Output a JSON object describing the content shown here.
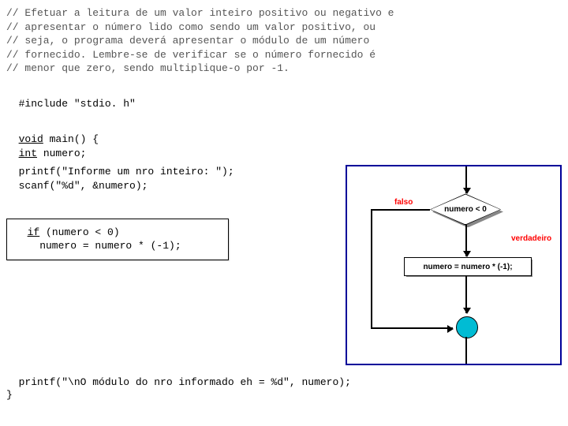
{
  "comments": {
    "l1": "// Efetuar a leitura de um valor inteiro positivo ou negativo e",
    "l2": "// apresentar o número lido como sendo um valor positivo, ou",
    "l3": "// seja, o programa deverá apresentar o módulo de um número",
    "l4": "// fornecido. Lembre-se de verificar se o número fornecido é",
    "l5": "// menor que zero, sendo multiplique-o por -1."
  },
  "code": {
    "include_pre": "#include",
    "include_hdr": " \"stdio. h\"",
    "void": "void",
    "main_sig": " main() {",
    "int": "int",
    "decl": " numero;",
    "printf1": "  printf(\"Informe um nro inteiro: \");",
    "scanf": "  scanf(\"%d\", &numero);",
    "if_kw": "if",
    "if_cond": " (numero < 0)",
    "if_body": "    numero = numero * (-1);",
    "printf2": "  printf(\"\\nO módulo do nro informado eh = %d\", numero);",
    "close": "}"
  },
  "flow": {
    "false_label": "falso",
    "true_label": "verdadeiro",
    "cond": "numero < 0",
    "op": "numero = numero * (-1);"
  }
}
